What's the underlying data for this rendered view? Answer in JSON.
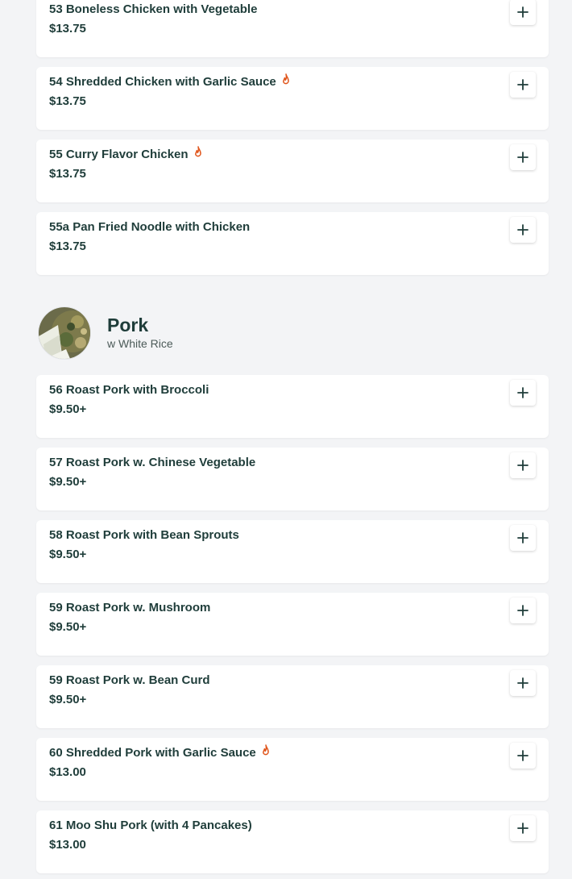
{
  "colors": {
    "text": "#1f3d3a",
    "spicy": "#e0551b",
    "card_bg": "#ffffff",
    "page_bg": "#f3f4f6"
  },
  "icons": {
    "add": "plus-icon",
    "spicy": "flame-icon"
  },
  "top_items": [
    {
      "name": "53 Boneless Chicken with Vegetable",
      "price": "$13.75",
      "spicy": false
    },
    {
      "name": "54 Shredded Chicken with Garlic Sauce",
      "price": "$13.75",
      "spicy": true
    },
    {
      "name": "55 Curry Flavor Chicken",
      "price": "$13.75",
      "spicy": true
    },
    {
      "name": "55a Pan Fried Noodle with Chicken",
      "price": "$13.75",
      "spicy": false
    }
  ],
  "section": {
    "title": "Pork",
    "subtitle": "w White Rice"
  },
  "pork_items": [
    {
      "name": "56 Roast Pork with Broccoli",
      "price": "$9.50+",
      "spicy": false
    },
    {
      "name": "57 Roast Pork w. Chinese Vegetable",
      "price": "$9.50+",
      "spicy": false
    },
    {
      "name": "58 Roast Pork with Bean Sprouts",
      "price": "$9.50+",
      "spicy": false
    },
    {
      "name": "59 Roast Pork w. Mushroom",
      "price": "$9.50+",
      "spicy": false
    },
    {
      "name": "59 Roast Pork w. Bean Curd",
      "price": "$9.50+",
      "spicy": false
    },
    {
      "name": "60 Shredded Pork with Garlic Sauce",
      "price": "$13.00",
      "spicy": true
    },
    {
      "name": "61 Moo Shu Pork (with 4 Pancakes)",
      "price": "$13.00",
      "spicy": false
    }
  ]
}
